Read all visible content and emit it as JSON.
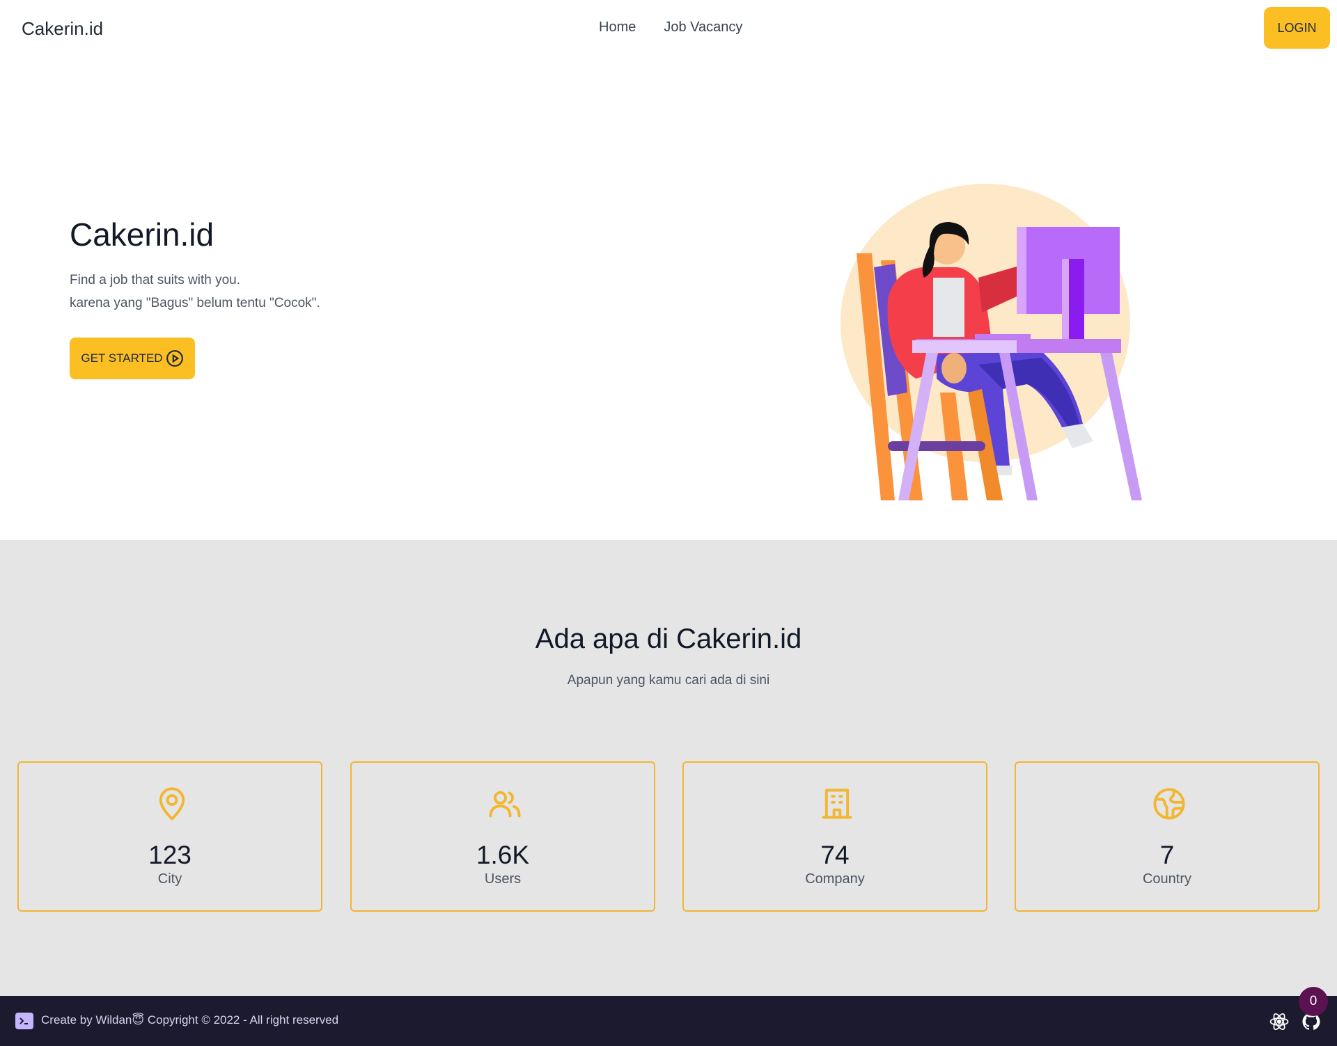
{
  "nav": {
    "brand": "Cakerin.id",
    "links": [
      "Home",
      "Job Vacancy"
    ],
    "login_label": "LOGIN"
  },
  "hero": {
    "title": "Cakerin.id",
    "subtitle_line1": "Find a job that suits with you.",
    "subtitle_line2": "karena yang \"Bagus\" belum tentu \"Cocok\".",
    "cta_label": "GET STARTED",
    "cta_icon": "play-circle-icon",
    "illustration": "woman-at-computer-desk-illustration"
  },
  "stats": {
    "title": "Ada apa di Cakerin.id",
    "subtitle": "Apapun yang kamu cari ada di sini",
    "items": [
      {
        "icon": "location-pin-icon",
        "value": "123",
        "label": "City"
      },
      {
        "icon": "users-icon",
        "value": "1.6K",
        "label": "Users"
      },
      {
        "icon": "building-icon",
        "value": "74",
        "label": "Company"
      },
      {
        "icon": "globe-icon",
        "value": "7",
        "label": "Country"
      }
    ]
  },
  "footer": {
    "text": "Create by Wildan😇 Copyright © 2022 - All right reserved",
    "icons": [
      "terminal-icon",
      "react-icon",
      "github-icon"
    ],
    "badge_count": "0"
  },
  "colors": {
    "accent": "#fbbf24",
    "card_border": "#f2b632",
    "stats_bg": "#e5e5e5",
    "footer_bg": "#1b1a2e"
  }
}
